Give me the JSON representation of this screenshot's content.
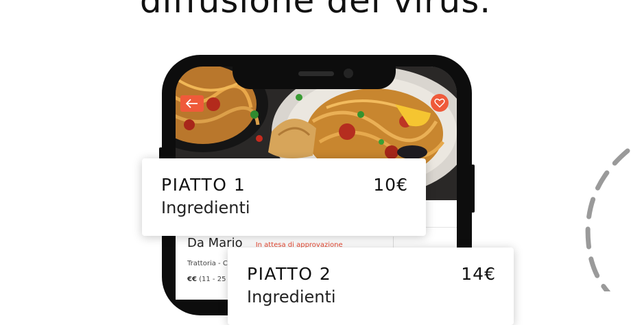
{
  "headline": "diffusione del virus.",
  "restaurant": {
    "name": "Da Mario",
    "status": "In attesa di approvazione",
    "type": "Trattoria - C",
    "price_level": "€€",
    "price_range": "(11 - 25"
  },
  "cards": [
    {
      "dish": "PIATTO 1",
      "price": "10€",
      "ingredients": "Ingredienti"
    },
    {
      "dish": "PIATTO 2",
      "price": "14€",
      "ingredients": "Ingredienti"
    }
  ],
  "colors": {
    "accent": "#ef5a3a",
    "phone": "#0d0d0d"
  },
  "icons": {
    "back": "arrow-left-icon",
    "favorite": "heart-icon"
  }
}
